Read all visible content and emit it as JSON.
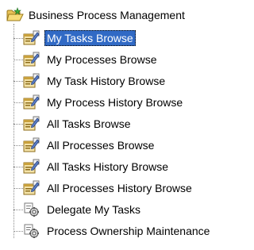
{
  "tree": {
    "root": {
      "label": "Business Process Management",
      "icon": "open-folder-icon"
    },
    "items": [
      {
        "label": "My Tasks Browse",
        "icon": "browse-form-icon",
        "selected": true
      },
      {
        "label": "My Processes Browse",
        "icon": "browse-form-icon",
        "selected": false
      },
      {
        "label": "My Task History Browse",
        "icon": "browse-form-icon",
        "selected": false
      },
      {
        "label": "My Process History Browse",
        "icon": "browse-form-icon",
        "selected": false
      },
      {
        "label": "All Tasks Browse",
        "icon": "browse-form-icon",
        "selected": false
      },
      {
        "label": "All Processes Browse",
        "icon": "browse-form-icon",
        "selected": false
      },
      {
        "label": "All Tasks History Browse",
        "icon": "browse-form-icon",
        "selected": false
      },
      {
        "label": "All Processes History Browse",
        "icon": "browse-form-icon",
        "selected": false
      },
      {
        "label": "Delegate My Tasks",
        "icon": "maintenance-gear-icon",
        "selected": false
      },
      {
        "label": "Process Ownership Maintenance",
        "icon": "maintenance-gear-icon",
        "selected": false
      }
    ]
  },
  "colors": {
    "selection": "#316ac5",
    "selection_text": "#ffffff",
    "connector": "#8a8a8a"
  }
}
